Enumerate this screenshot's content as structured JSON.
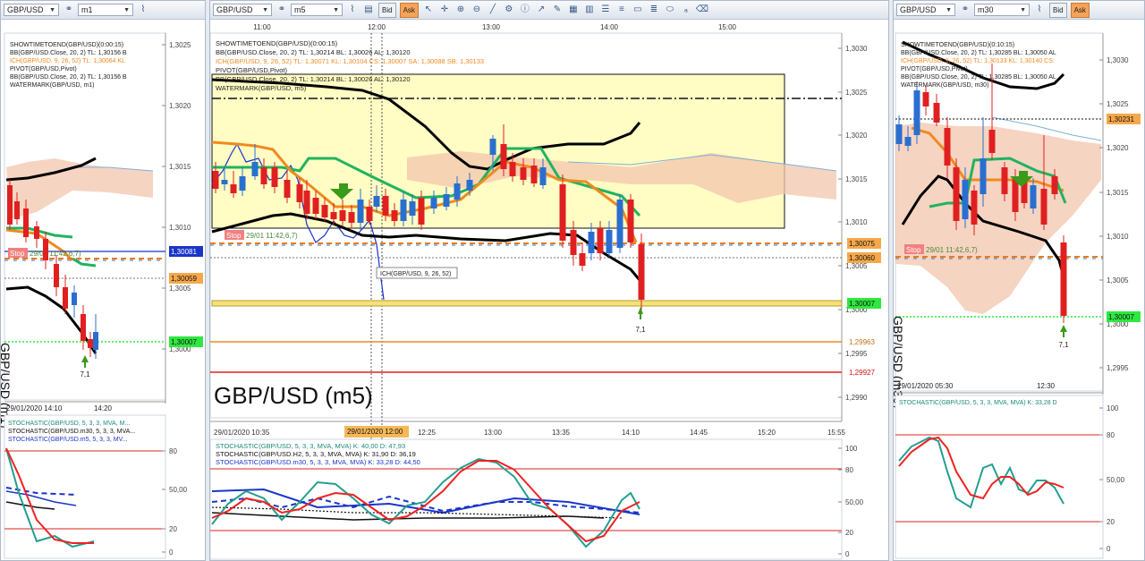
{
  "left": {
    "toolbar": {
      "symbol": "GBP/USD",
      "timeframe": "m1"
    },
    "overlays": [
      "SHOWTIMETOEND(GBP/USD)(0:00:15)",
      "BB(GBP/USD.Close, 20, 2)  TL: 1,30156  B",
      "ICH(GBP/USD, 9, 26, 52)  TL: 1,30064  KL",
      "PIVOT(GBP/USD,Pivot)",
      "BB(GBP/USD.Close, 20, 2)  TL: 1,30156  B",
      "WATERMARK(GBP/USD, m1)"
    ],
    "price_ticks": [
      "1,3025",
      "1,3020",
      "1,3015",
      "1,3010",
      "1,3005",
      "1,3000"
    ],
    "tags": [
      "1,30081",
      "1,30059",
      "1,30007"
    ],
    "stop_label": "Stop",
    "stop_text": "29/01 11:42,6,7)",
    "arrow_label": "7,1",
    "watermark": "GBP/USD (m1)",
    "time_labels": [
      "29/01/2020 14:10",
      "14:20"
    ],
    "stoch": [
      "STOCHASTIC(GBP/USD, 5, 3, 3, MVA, M...",
      "STOCHASTIC(GBP/USD.m30, 5, 3, 3, MVA...",
      "STOCHASTIC(GBP/USD.m5, 5, 3, 3, MV..."
    ],
    "stoch_ticks": [
      "80",
      "50,00",
      "20",
      "0"
    ]
  },
  "mid": {
    "toolbar": {
      "symbol": "GBP/USD",
      "timeframe": "m5",
      "bid": "Bid",
      "ask": "Ask"
    },
    "top_times": [
      "11:00",
      "12:00",
      "13:00",
      "14:00",
      "15:00"
    ],
    "overlays": [
      "SHOWTIMETOEND(GBP/USD)(0:00:15)",
      "BB(GBP/USD.Close, 20, 2)  TL: 1,30214  BL: 1,30026  AL: 1,30120",
      "ICH(GBP/USD, 9, 26, 52)  TL: 1,30071  KL: 1,30104  CS: 1,30007  SA: 1,30088  SB: 1,30133",
      "PIVOT(GBP/USD,Pivot)",
      "BB(GBP/USD.Close, 20, 2)  TL: 1,30214  BL: 1,30026  AL: 1,30120",
      "WATERMARK(GBP/USD, m5)"
    ],
    "price_ticks": [
      "1,3030",
      "1,3025",
      "1,3020",
      "1,3015",
      "1,3010",
      "1,3005",
      "1,3000",
      "1,2995",
      "1,2990"
    ],
    "tags": [
      "1,30075",
      "1,30060",
      "1,30007",
      "1,29963",
      "1,29927"
    ],
    "stop_label": "Stop",
    "stop_text": "29/01 11:42,6,7)",
    "ich_label": "ICH(GBP/USD, 9, 26, 52)",
    "arrow_label": "7,1",
    "watermark": "GBP/USD (m5)",
    "bottom_times": [
      "29/01/2020 10:35",
      "12:25",
      "13:00",
      "13:35",
      "14:10",
      "14:45",
      "15:20",
      "15:55"
    ],
    "cursor_time": "29/01/2020 12:00",
    "stoch": [
      "STOCHASTIC(GBP/USD, 5, 3, 3, MVA, MVA)  K: 40,00  D: 47,93",
      "STOCHASTIC(GBP/USD.H2, 5, 3, 3, MVA, MVA)  K: 31,90  D: 36,19",
      "STOCHASTIC(GBP/USD.m30, 5, 3, 3, MVA, MVA)  K: 33,28  D: 44,50"
    ],
    "stoch_ticks": [
      "100",
      "80",
      "50,00",
      "20",
      "0"
    ]
  },
  "right": {
    "toolbar": {
      "symbol": "GBP/USD",
      "timeframe": "m30",
      "bid": "Bid",
      "ask": "Ask"
    },
    "overlays": [
      "SHOWTIMETOEND(GBP/USD)(0:10:15)",
      "BB(GBP/USD.Close, 20, 2)  TL: 1,30285  BL: 1,30050  AL",
      "ICH(GBP/USD, 9, 26, 52)  TL: 1,30133  KL: 1,30140  CS:",
      "PIVOT(GBP/USD,Pivot)",
      "BB(GBP/USD.Close, 20, 2)  TL: 1,30285  BL: 1,30050  AL",
      "WATERMARK(GBP/USD, m30)"
    ],
    "price_ticks": [
      "1,3030",
      "1,3025",
      "1,3020",
      "1,3015",
      "1,3010",
      "1,3005",
      "1,3000",
      "1,2995"
    ],
    "tags": [
      "1,30231",
      "1,30007"
    ],
    "stop_label": "Stop",
    "stop_text": "29/01 11:42,6,7)",
    "arrow_label": "7,1",
    "watermark": "GBP/USD (m30)",
    "bottom_times": [
      "29/01/2020 05:30",
      "12:30"
    ],
    "stoch": [
      "STOCHASTIC(GBP/USD, 5, 3, 3, MVA, MVA)  K: 33,28  D"
    ],
    "stoch_ticks": [
      "100",
      "80",
      "50,00",
      "20",
      "0"
    ]
  },
  "colors": {
    "red_candle": "#e02020",
    "blue_candle": "#2a6fd0",
    "bb": "#000000",
    "tenkan": "#f08a20",
    "kijun": "#21b35e",
    "cloud": "#f3c6ae",
    "yellow_box": "#fffcc4",
    "stoch_k": "#239e8f",
    "stoch_d": "#ee2222"
  },
  "chart_data": [
    {
      "type": "candlestick",
      "timeframe": "m1",
      "title": "GBP/USD (m1)",
      "ylim": [
        1.2995,
        1.3027
      ],
      "x": [
        "29/01/2020 14:10",
        "14:20"
      ]
    },
    {
      "type": "candlestick",
      "timeframe": "m5",
      "title": "GBP/USD (m5)",
      "ylim": [
        1.2987,
        1.3032
      ],
      "x": [
        "29/01/2020 10:35",
        "12:25",
        "13:00",
        "13:35",
        "14:10",
        "14:45",
        "15:20",
        "15:55"
      ],
      "last_close": 1.30007,
      "levels": [
        1.30075,
        1.3006,
        1.30007,
        1.29963,
        1.29927
      ]
    },
    {
      "type": "candlestick",
      "timeframe": "m30",
      "title": "GBP/USD (m30)",
      "ylim": [
        1.2993,
        1.3033
      ],
      "x": [
        "29/01/2020 05:30",
        "12:30"
      ],
      "levels": [
        1.30231,
        1.30007
      ]
    }
  ]
}
